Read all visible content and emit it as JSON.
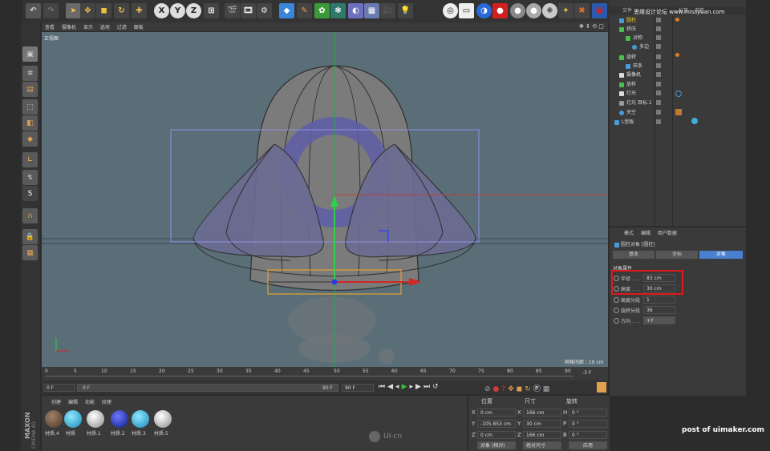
{
  "toolbar": {
    "numbers": [
      "0",
      "1"
    ]
  },
  "viewport": {
    "menu": [
      "查看",
      "摄像机",
      "显示",
      "选项",
      "过滤",
      "面板"
    ],
    "view_name": "正视图",
    "grid_spacing": "网格间距 : 10 cm"
  },
  "object_manager": {
    "menu": [
      "文件",
      "编辑",
      "查看",
      "对象",
      "标签",
      "书签"
    ],
    "objects": [
      "圆柱",
      "挤压",
      "对称",
      "多边",
      "旋转",
      "样条",
      "摄像机",
      "放样",
      "灯光",
      "灯光 目标.1",
      "天空",
      "L型板"
    ]
  },
  "watermark": "思缘设计论坛  www.missyuan.com",
  "attributes": {
    "menu": [
      "模式",
      "编辑",
      "用户数据"
    ],
    "object_title": "圆柱对象 [圆柱]",
    "tabs": [
      "基本",
      "坐标",
      "对象"
    ],
    "section": "对象属性",
    "fields": [
      {
        "label": "半径 . . .",
        "value": "83 cm"
      },
      {
        "label": "高度 . . .",
        "value": "30 cm"
      },
      {
        "label": "高度分段",
        "value": "1"
      },
      {
        "label": "旋转分段",
        "value": "36"
      },
      {
        "label": "方向 . . .",
        "value": "+Y"
      }
    ]
  },
  "timeline": {
    "ticks": [
      "0",
      "5",
      "10",
      "15",
      "20",
      "25",
      "30",
      "35",
      "40",
      "45",
      "50",
      "55",
      "60",
      "65",
      "70",
      "75",
      "80",
      "85",
      "90"
    ],
    "current_frame": "-3 F",
    "start": "0 F",
    "slider_left": "0 F",
    "slider_right": "90 F",
    "end": "90 F"
  },
  "materials": {
    "menu": [
      "创建",
      "编辑",
      "功能",
      "纹理"
    ],
    "items": [
      "材质.4",
      "材质",
      "材质.1",
      "材质.2",
      "材质.3",
      "材质.5"
    ]
  },
  "coordinates": {
    "headers": [
      "位置",
      "尺寸",
      "旋转"
    ],
    "rows": [
      {
        "axis": "X",
        "pos": "0 cm",
        "size_axis": "X",
        "size": "166 cm",
        "rot_axis": "H",
        "rot": "0 °"
      },
      {
        "axis": "Y",
        "pos": "-105.853 cm",
        "size_axis": "Y",
        "size": "30 cm",
        "rot_axis": "P",
        "rot": "0 °"
      },
      {
        "axis": "Z",
        "pos": "0 cm",
        "size_axis": "Z",
        "size": "166 cm",
        "rot_axis": "B",
        "rot": "0 °"
      }
    ],
    "mode": "对象 (相对)",
    "size_mode": "绝对尺寸",
    "apply": "应用"
  },
  "brand": {
    "line1": "MAXON",
    "line2": "CINEMA 4D",
    "site": "UI-cn",
    "credit": "post of uimaker.com"
  },
  "colors": {
    "accent": "#4a7fd0",
    "highlight_box": "#e0191b",
    "viewport_bg": "#5a6e78"
  }
}
